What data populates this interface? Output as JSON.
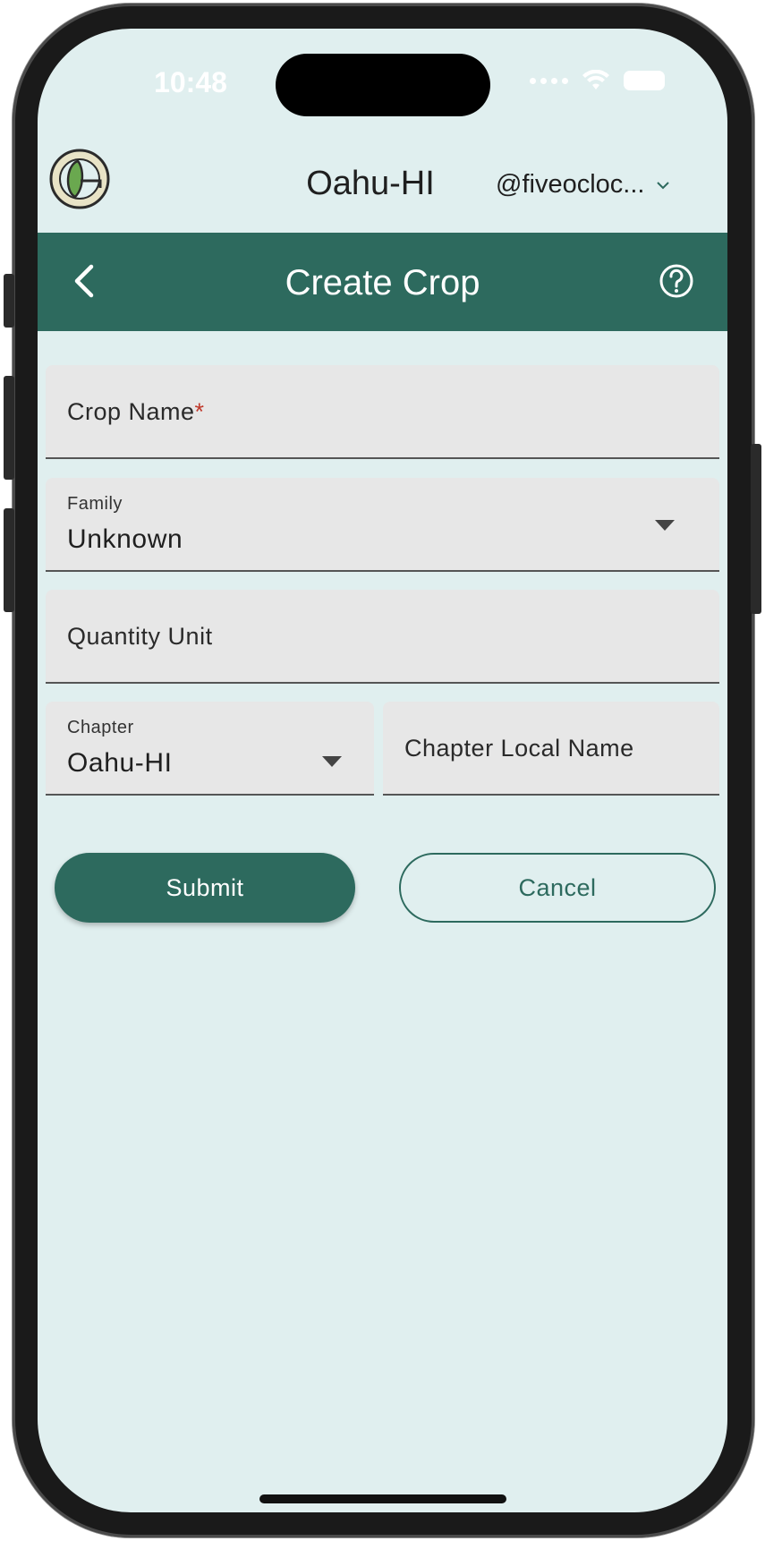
{
  "status_bar": {
    "time": "10:48"
  },
  "header": {
    "chapter": "Oahu-HI",
    "account": "@fiveocloc..."
  },
  "titlebar": {
    "title": "Create Crop"
  },
  "form": {
    "crop_name": {
      "label": "Crop Name",
      "required_mark": "*"
    },
    "family": {
      "label": "Family",
      "value": "Unknown"
    },
    "quantity_unit": {
      "label": "Quantity Unit"
    },
    "chapter": {
      "label": "Chapter",
      "value": "Oahu-HI"
    },
    "chapter_local_name": {
      "label": "Chapter Local Name"
    }
  },
  "actions": {
    "submit": "Submit",
    "cancel": "Cancel"
  },
  "colors": {
    "primary": "#2d6a5e",
    "background": "#e0efef",
    "field": "#e7e7e7",
    "required": "#c0392b"
  },
  "icons": [
    "back-icon",
    "help-icon",
    "chevron-down-icon",
    "dropdown-arrow-icon",
    "wifi-icon",
    "battery-icon",
    "logo"
  ]
}
